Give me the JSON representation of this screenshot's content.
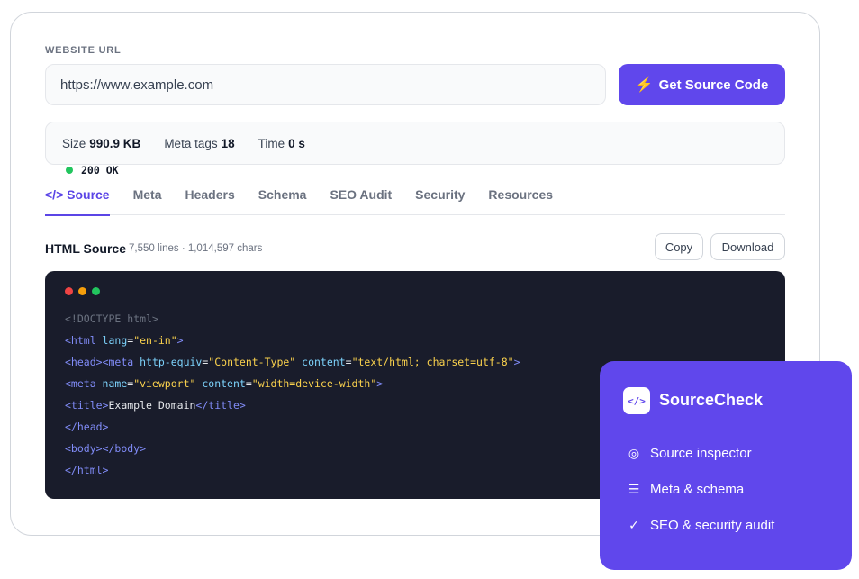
{
  "form": {
    "label": "WEBSITE URL",
    "url_value": "https://www.example.com",
    "button_label": "Get Source Code",
    "button_icon": "bolt-icon"
  },
  "status": {
    "code": "200 OK",
    "size_label": "Size",
    "size_value": "990.9 KB",
    "meta_label": "Meta tags",
    "meta_value": "18",
    "time_label": "Time",
    "time_value": "0 s",
    "ok_color": "#22c55e"
  },
  "tabs": [
    {
      "label": "</> Source",
      "active": true
    },
    {
      "label": "Meta"
    },
    {
      "label": "Headers"
    },
    {
      "label": "Schema"
    },
    {
      "label": "SEO Audit"
    },
    {
      "label": "Security"
    },
    {
      "label": "Resources"
    }
  ],
  "source": {
    "title": "HTML Source",
    "meta": "7,550 lines · 1,014,597 chars",
    "copy_label": "Copy",
    "download_label": "Download",
    "window_dots": [
      "#ef4444",
      "#f59e0b",
      "#22c55e"
    ],
    "lines": [
      "<!DOCTYPE html>",
      "<html lang=\"en-in\">",
      "<head><meta http-equiv=\"Content-Type\" content=\"text/html; charset=utf-8\">",
      "<meta name=\"viewport\" content=\"width=device-width\">",
      "<title>Example Domain</title>",
      "</head>",
      "<body></body>",
      "</html>"
    ]
  },
  "promo": {
    "logo_text": "</>",
    "brand": "SourceCheck",
    "features": [
      {
        "icon": "target-icon",
        "glyph": "◎",
        "label": "Source inspector"
      },
      {
        "icon": "list-icon",
        "glyph": "☰",
        "label": "Meta & schema"
      },
      {
        "icon": "check-icon",
        "glyph": "✓",
        "label": "SEO & security audit"
      }
    ]
  },
  "colors": {
    "accent": "#6047ec",
    "code_bg": "#191c2b"
  }
}
